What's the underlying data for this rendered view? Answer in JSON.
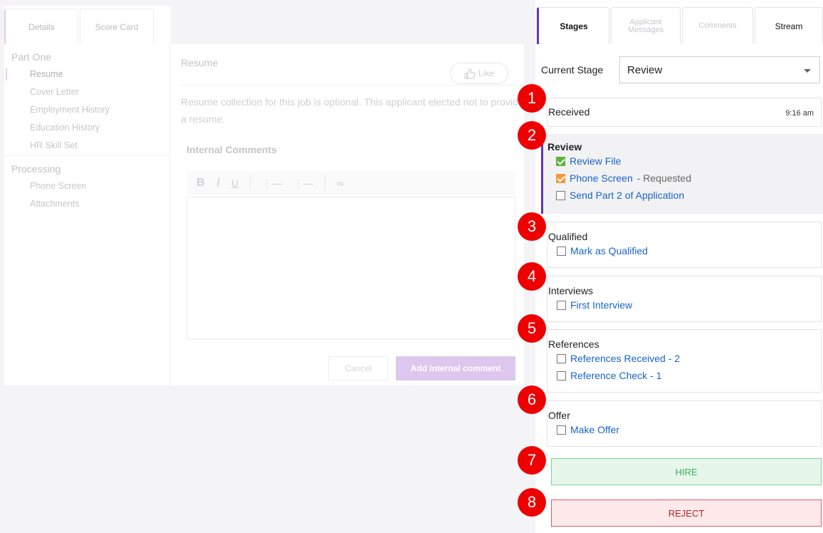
{
  "left": {
    "tabs": [
      "Details",
      "Score Card"
    ],
    "nav": {
      "group1": "Part One",
      "group1_items": [
        "Resume",
        "Cover Letter",
        "Employment History",
        "Education History",
        "HR Skill Set"
      ],
      "group2": "Processing",
      "group2_items": [
        "Phone Screen",
        "Attachments"
      ]
    },
    "content": {
      "title": "Resume",
      "like_label": "Like",
      "message": "Resume collection for this job is optional. This applicant elected not to provide a resume.",
      "internal_comments_title": "Internal Comments",
      "toolbar_icons": [
        "bold-icon",
        "italic-icon",
        "underline-icon",
        "bullet-list-icon",
        "numbered-list-icon",
        "link-icon"
      ],
      "cancel_label": "Cancel",
      "add_comment_label": "Add internal comment"
    }
  },
  "right": {
    "tabs": {
      "stages": "Stages",
      "messages_line1": "Applicant",
      "messages_line2": "Messages",
      "comments": "Comments",
      "stream": "Stream"
    },
    "current_stage_label": "Current Stage",
    "current_stage_value": "Review",
    "stages": {
      "received": {
        "title": "Received",
        "time": "9:16 am"
      },
      "review": {
        "title": "Review",
        "tasks": [
          {
            "label": "Review File",
            "status": "done"
          },
          {
            "label": "Phone Screen",
            "suffix": "- Requested",
            "status": "requested"
          },
          {
            "label": "Send Part 2 of Application",
            "status": "open"
          }
        ]
      },
      "qualified": {
        "title": "Qualified",
        "tasks": [
          {
            "label": "Mark as Qualified"
          }
        ]
      },
      "interviews": {
        "title": "Interviews",
        "tasks": [
          {
            "label": "First Interview"
          }
        ]
      },
      "references": {
        "title": "References",
        "tasks": [
          {
            "label": "References Received - 2"
          },
          {
            "label": "Reference Check - 1"
          }
        ]
      },
      "offer": {
        "title": "Offer",
        "tasks": [
          {
            "label": "Make Offer"
          }
        ]
      }
    },
    "hire_label": "HIRE",
    "reject_label": "REJECT"
  },
  "badges": [
    "1",
    "2",
    "3",
    "4",
    "5",
    "6",
    "7",
    "8"
  ],
  "colors": {
    "accent": "#6b2fc2",
    "badge": "#ef0000",
    "link": "#1a63c8",
    "hire_bg": "#e6f6ea",
    "reject_bg": "#fde9ea"
  }
}
